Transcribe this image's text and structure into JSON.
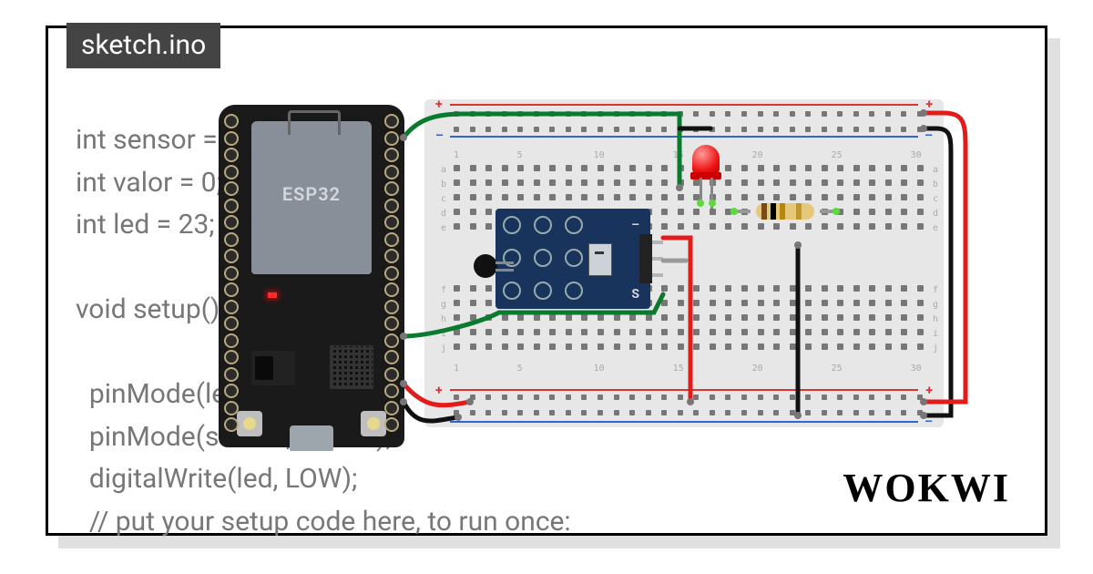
{
  "tab": {
    "filename": "sketch.ino"
  },
  "code": {
    "text": "int sensor = 2;\nint valor = 0;\nint led = 23;\n\nvoid setup()\n\n  pinMode(le\n  pinMode(sensor, INPUT);\n  digitalWrite(led, LOW);\n  // put your setup code here, to run once:"
  },
  "board": {
    "label": "ESP32"
  },
  "sensor": {
    "minus": "–",
    "signal": "S"
  },
  "breadboard": {
    "cols": [
      "1",
      "5",
      "10",
      "15",
      "20",
      "25",
      "30"
    ],
    "rows_top": [
      "a",
      "b",
      "c",
      "d",
      "e"
    ],
    "rows_bot": [
      "f",
      "g",
      "h",
      "i",
      "j"
    ]
  },
  "brand": {
    "name": "WOKWI"
  },
  "components": {
    "mcu": "ESP32 DevKit",
    "sensor_module": "KY-013 analog temperature sensor",
    "led": "red 5mm LED",
    "resistor": "220Ω (red-black-brown-gold approx)",
    "wires": [
      {
        "color": "green",
        "from": "ESP32 D23",
        "to": "breadboard a15"
      },
      {
        "color": "green",
        "from": "ESP32 D2",
        "to": "sensor S"
      },
      {
        "color": "grey",
        "from": "sensor middle",
        "to": "breadboard row"
      },
      {
        "color": "red",
        "from": "sensor -",
        "to": "bottom + rail"
      },
      {
        "color": "red",
        "from": "ESP32 3V3",
        "to": "bottom + rail"
      },
      {
        "color": "black",
        "from": "ESP32 GND",
        "to": "bottom - rail"
      },
      {
        "color": "black",
        "from": "top - rail",
        "to": "bottom - rail (right)"
      },
      {
        "color": "red",
        "from": "top + rail",
        "to": "bottom + rail (right)"
      },
      {
        "color": "black",
        "from": "breadboard j23",
        "to": "bottom - rail"
      }
    ]
  }
}
